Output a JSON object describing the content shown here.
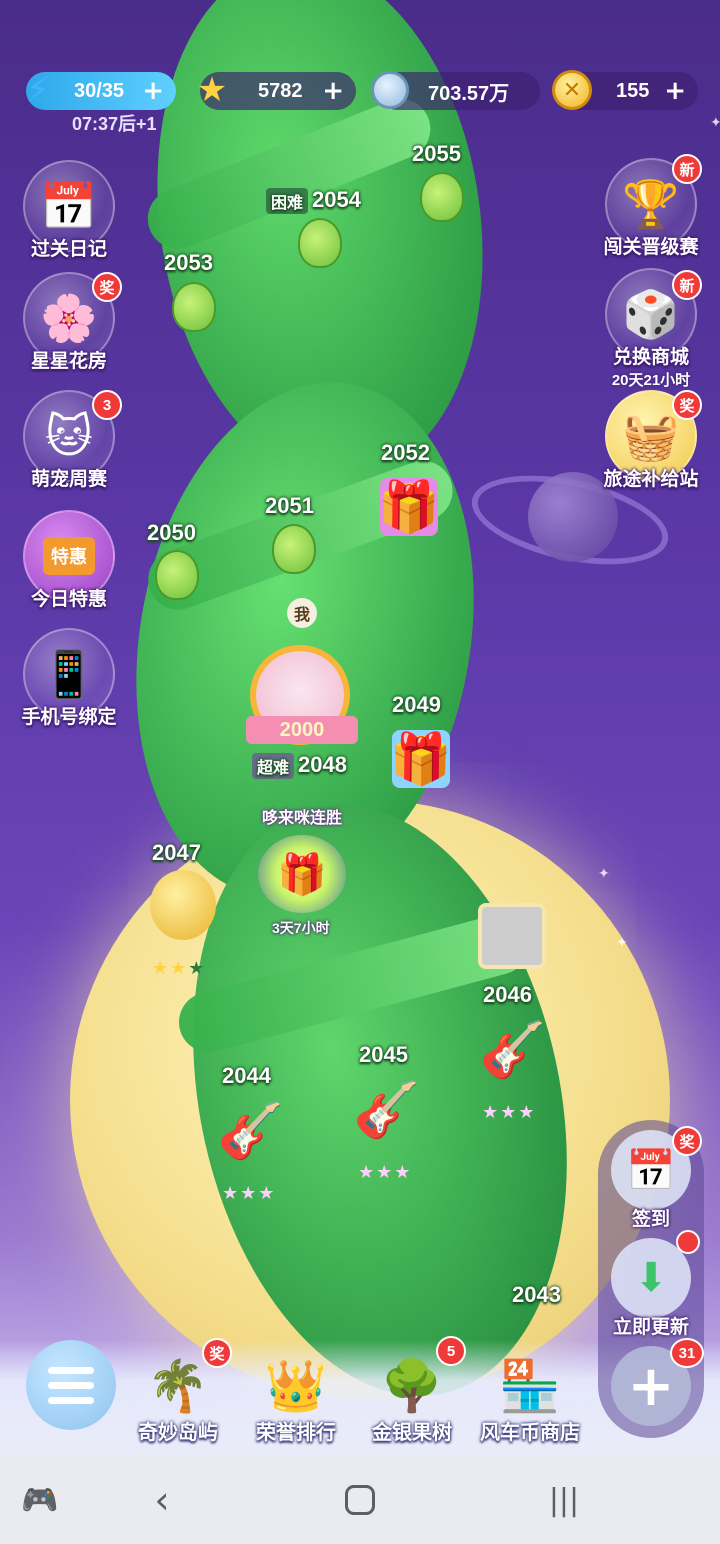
{
  "resources": {
    "energy": {
      "value": "30/35",
      "timer": "07:37后+1",
      "icon": "lightning-icon"
    },
    "stars": {
      "value": "5782",
      "icon": "star-icon"
    },
    "silver": {
      "value": "703.57万",
      "icon": "silver-coin-icon"
    },
    "gold": {
      "value": "155",
      "icon": "gold-coin-icon"
    }
  },
  "left_menu": [
    {
      "label": "过关日记",
      "badge": "",
      "icon": "calendar-icon"
    },
    {
      "label": "星星花房",
      "badge": "奖",
      "icon": "flower-icon"
    },
    {
      "label": "萌宠周赛",
      "badge": "3",
      "icon": "cat-icon"
    },
    {
      "label": "今日特惠",
      "badge": "",
      "icon": "shop-icon",
      "inner_text": "特惠"
    },
    {
      "label": "手机号绑定",
      "badge": "",
      "icon": "phone-icon"
    }
  ],
  "right_menu": [
    {
      "label": "闯关晋级赛",
      "badge": "新",
      "icon": "trophy-icon"
    },
    {
      "label": "兑换商城",
      "sub": "20天21小时",
      "badge": "新",
      "icon": "exchange-box-icon"
    },
    {
      "label": "旅途补给站",
      "badge": "奖",
      "icon": "supply-box-icon"
    }
  ],
  "levels": [
    {
      "number": "2055",
      "tag": ""
    },
    {
      "number": "2054",
      "tag": "困难"
    },
    {
      "number": "2053",
      "tag": ""
    },
    {
      "number": "2052",
      "tag": ""
    },
    {
      "number": "2051",
      "tag": ""
    },
    {
      "number": "2050",
      "tag": ""
    },
    {
      "number": "2049",
      "tag": ""
    },
    {
      "number": "2048",
      "tag": "超难"
    },
    {
      "number": "2047",
      "tag": ""
    },
    {
      "number": "2046",
      "tag": ""
    },
    {
      "number": "2045",
      "tag": ""
    },
    {
      "number": "2044",
      "tag": ""
    },
    {
      "number": "2043",
      "tag": ""
    }
  ],
  "player": {
    "me_label": "我",
    "frame_number": "2000"
  },
  "event": {
    "title": "哆来咪连胜",
    "timer": "3天7小时"
  },
  "level_stars": {
    "2047": "3 of 3 (2 gold)",
    "2046": "3 of 3",
    "2045": "3 of 3",
    "2044": "3 of 3"
  },
  "dock": [
    {
      "label": "奇妙岛屿",
      "badge": "奖",
      "icon": "palm-island-icon"
    },
    {
      "label": "荣誉排行",
      "badge": "",
      "icon": "crown-icon"
    },
    {
      "label": "金银果树",
      "badge": "5",
      "icon": "fruit-tree-icon"
    },
    {
      "label": "风车币商店",
      "badge": "",
      "icon": "store-icon"
    }
  ],
  "right_panel": [
    {
      "label": "签到",
      "badge": "奖",
      "icon": "checkin-calendar-icon"
    },
    {
      "label": "立即更新",
      "badge": "",
      "icon": "cloud-download-icon"
    },
    {
      "label": "",
      "badge": "31",
      "icon": "plus-icon"
    }
  ],
  "colors": {
    "background": "#5b38a6",
    "moon": "#f5df8e",
    "stalk": "#3cbf52",
    "badge": "#f03a3a"
  }
}
